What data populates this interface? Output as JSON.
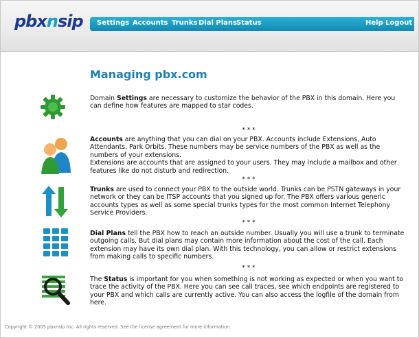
{
  "header": {
    "logo": {
      "part1": "pbx",
      "part2": "n",
      "part3": "sip"
    },
    "nav": {
      "settings": "Settings",
      "accounts": "Accounts",
      "trunks": "Trunks",
      "dial_plans": "Dial Plans",
      "status": "Status",
      "help": "Help",
      "logout": "Logout"
    }
  },
  "main": {
    "title": "Managing pbx.com",
    "separator": "* * *",
    "settings": {
      "term": "Settings",
      "before": "Domain ",
      "after": " are necessary to customize the behavior of the PBX in this domain. Here you can define how features are mapped to star codes."
    },
    "accounts": {
      "term": "Accounts",
      "after": " are anything that you can dial on your PBX. Accounts include Extensions, Auto Attendants, Park Orbits. These numbers may be service numbers of the PBX as well as the numbers of your extensions.",
      "line2": "Extensions are accounts that are assigned to your users. They may include a mailbox and other features like do not disturb and redirection."
    },
    "trunks": {
      "term": "Trunks",
      "after": " are used to connect your PBX to the outside world. Trunks can be PSTN gateways in your network or they can be ITSP accounts that you signed up for. The PBX offers various generic accounts types as well as some special trunks types for the most common Internet Telephony Service Providers."
    },
    "dial_plans": {
      "term": "Dial Plans",
      "after": " tell the PBX how to reach an outside number. Usually you will use a trunk to terminate outgoing calls. But dial plans may contain more information about the cost of the call. Each extension may have its own dial plan. With this technology, you can allow or restrict extensions from making calls to specific numbers."
    },
    "status": {
      "term": "Status",
      "before": "The ",
      "after": " is important for you when something is not working as expected or when you want to trace the activity of the PBX. Here you can see call traces, see which endpoints are registered to your PBX and which calls are currently active. You can also access the logfile of the domain from here."
    }
  },
  "footer": {
    "text": "Copyright © 2005 pbxnsip Inc. All rights reserved. See the license agreement for more information."
  },
  "colors": {
    "nav_bar": "#1d9ec8",
    "title": "#1d7fb0",
    "logo_dark": "#1d3b8f",
    "logo_accent": "#18a0c8"
  },
  "icons": [
    "gear-icon",
    "users-icon",
    "arrows-icon",
    "keypad-icon",
    "magnifier-icon"
  ]
}
